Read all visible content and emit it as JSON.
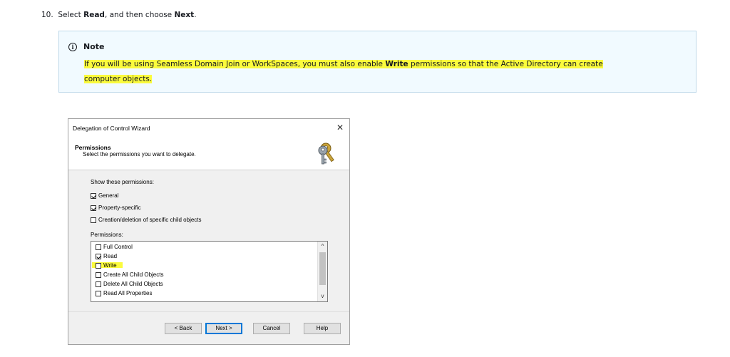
{
  "step": {
    "number": "10.",
    "text_1": "Select ",
    "read": "Read",
    "text_2": ", and then choose ",
    "next": "Next",
    "text_3": "."
  },
  "note": {
    "icon_glyph": "i",
    "title": "Note",
    "line1_a": "If you will be using Seamless Domain Join or WorkSpaces, you must also enable ",
    "line1_b": "Write",
    "line1_c": " permissions so that the Active Directory can create",
    "line2": "computer objects."
  },
  "wizard": {
    "title": "Delegation of Control Wizard",
    "close": "✕",
    "header_title": "Permissions",
    "header_subtitle": "Select the permissions you want to delegate.",
    "show_label": "Show these permissions:",
    "filters": [
      {
        "label": "General",
        "checked": true
      },
      {
        "label": "Property-specific",
        "checked": true
      },
      {
        "label": "Creation/deletion of specific child objects",
        "checked": false
      }
    ],
    "permissions_label": "Permissions:",
    "permissions": [
      {
        "label": "Full Control",
        "checked": false
      },
      {
        "label": "Read",
        "checked": true
      },
      {
        "label": "Write",
        "checked": false
      },
      {
        "label": "Create All Child Objects",
        "checked": false
      },
      {
        "label": "Delete All Child Objects",
        "checked": false
      },
      {
        "label": "Read All Properties",
        "checked": false
      }
    ],
    "scroll_up": "^",
    "scroll_down": "v",
    "buttons": {
      "back": "< Back",
      "next": "Next >",
      "cancel": "Cancel",
      "help": "Help"
    }
  },
  "colors": {
    "highlight": "#fbfb3d",
    "note_bg": "#f1faff",
    "note_border": "#bfd9ea"
  }
}
